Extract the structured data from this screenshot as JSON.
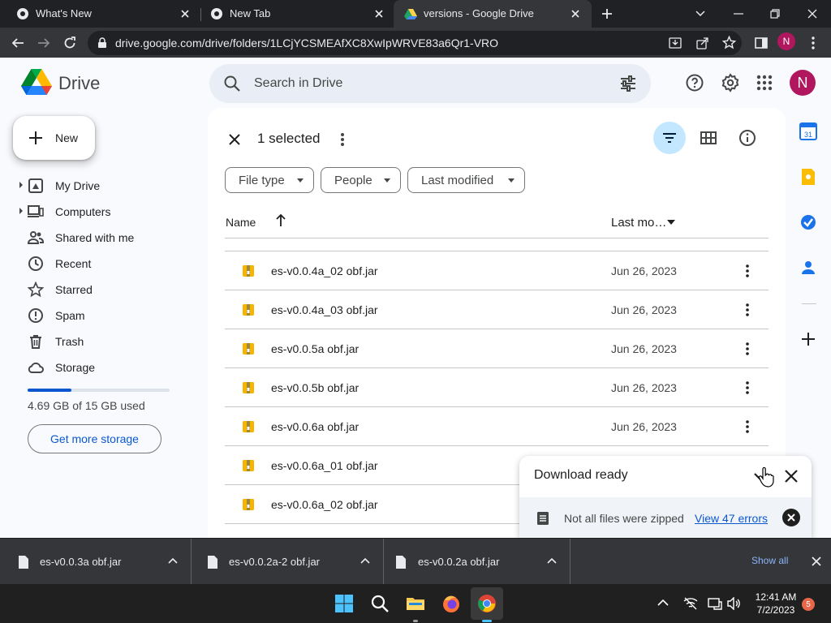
{
  "browser": {
    "tabs": [
      {
        "label": "What's New",
        "active": false
      },
      {
        "label": "New Tab",
        "active": false
      },
      {
        "label": "versions - Google Drive",
        "active": true
      }
    ],
    "url": "drive.google.com/drive/folders/1LCjYCSMEAfXC8XwIpWRVE83a6Qr1-VRO",
    "profile_initial": "N"
  },
  "drive": {
    "app_name": "Drive",
    "search_placeholder": "Search in Drive",
    "avatar_initial": "N",
    "new_label": "New",
    "nav": [
      {
        "label": "My Drive",
        "icon": "my-drive-icon"
      },
      {
        "label": "Computers",
        "icon": "computers-icon"
      },
      {
        "label": "Shared with me",
        "icon": "shared-icon"
      },
      {
        "label": "Recent",
        "icon": "recent-icon"
      },
      {
        "label": "Starred",
        "icon": "star-icon"
      },
      {
        "label": "Spam",
        "icon": "spam-icon"
      },
      {
        "label": "Trash",
        "icon": "trash-icon"
      },
      {
        "label": "Storage",
        "icon": "cloud-icon"
      }
    ],
    "storage": {
      "text": "4.69 GB of 15 GB used",
      "used_fraction": 0.31
    },
    "get_storage_label": "Get more storage",
    "selection": {
      "count_label": "1 selected"
    },
    "filters": [
      "File type",
      "People",
      "Last modified"
    ],
    "columns": {
      "name": "Name",
      "modified": "Last mo…"
    },
    "files": [
      {
        "name": "es-v0.0.4a_02 obf.jar",
        "modified": "Jun 26, 2023"
      },
      {
        "name": "es-v0.0.4a_03 obf.jar",
        "modified": "Jun 26, 2023"
      },
      {
        "name": "es-v0.0.5a obf.jar",
        "modified": "Jun 26, 2023"
      },
      {
        "name": "es-v0.0.5b obf.jar",
        "modified": "Jun 26, 2023"
      },
      {
        "name": "es-v0.0.6a obf.jar",
        "modified": "Jun 26, 2023"
      },
      {
        "name": "es-v0.0.6a_01 obf.jar",
        "modified": ""
      },
      {
        "name": "es-v0.0.6a_02 obf.jar",
        "modified": ""
      }
    ]
  },
  "download_popup": {
    "title": "Download ready",
    "message": "Not all files were zipped",
    "link": "View 47 errors"
  },
  "download_shelf": {
    "items": [
      "es-v0.0.3a obf.jar",
      "es-v0.0.2a-2 obf.jar",
      "es-v0.0.2a obf.jar"
    ],
    "show_all": "Show all"
  },
  "taskbar": {
    "time": "12:41 AM",
    "date": "7/2/2023",
    "notification_count": "5"
  }
}
